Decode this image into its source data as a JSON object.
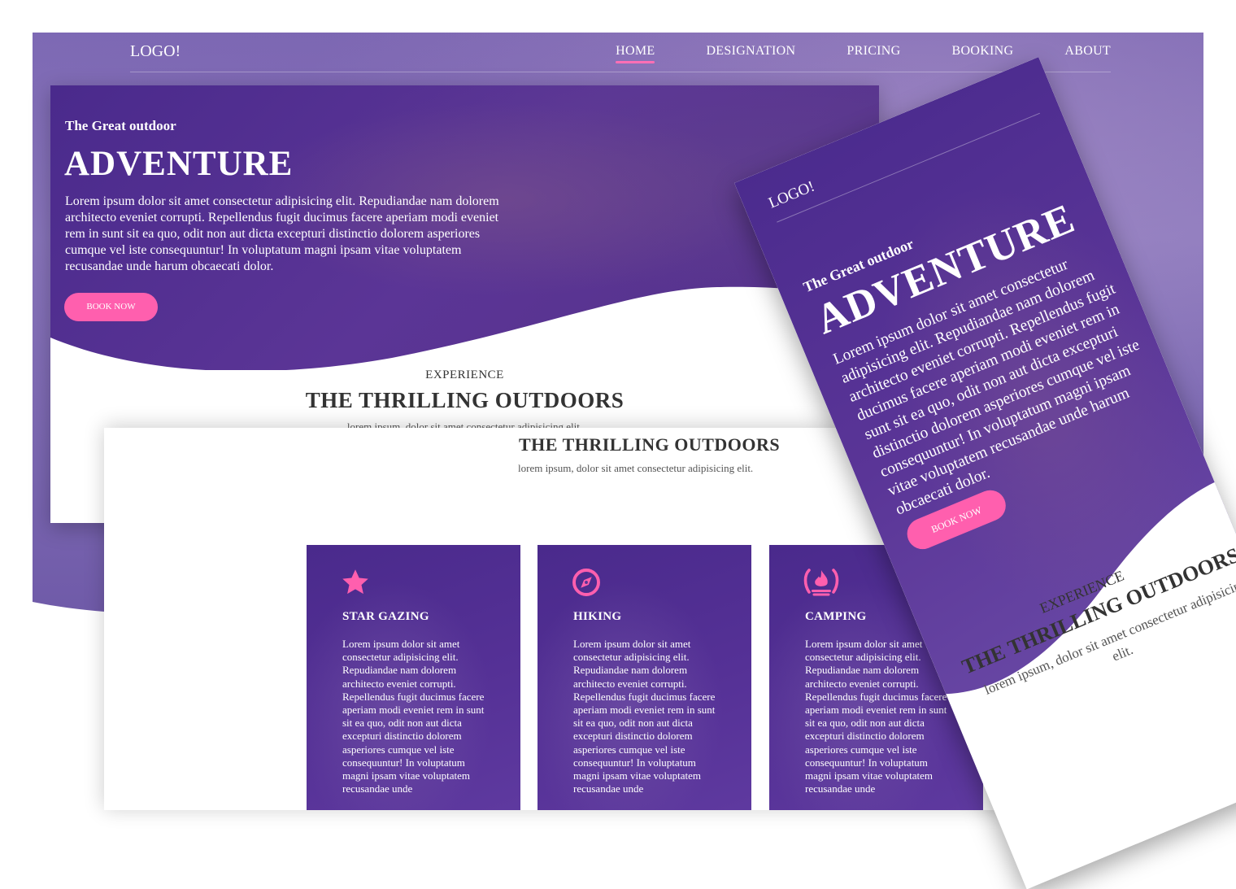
{
  "nav": {
    "logo": "LOGO!",
    "links": [
      "HOME",
      "DESIGNATION",
      "PRICING",
      "BOOKING",
      "ABOUT"
    ]
  },
  "hero": {
    "eyebrow": "The Great outdoor",
    "title": "ADVENTURE",
    "description": "Lorem ipsum dolor sit amet consectetur adipisicing elit. Repudiandae nam dolorem architecto eveniet corrupti. Repellendus fugit ducimus facere aperiam modi eveniet rem in sunt sit ea quo, odit non aut dicta excepturi distinctio dolorem asperiores cumque vel iste consequuntur! In voluptatum magni ipsam vitae voluptatem recusandae unde harum obcaecati dolor.",
    "cta": "BOOK NOW"
  },
  "experience": {
    "eyebrow": "EXPERIENCE",
    "title": "THE THRILLING OUTDOORS",
    "subtitle": "lorem ipsum, dolor sit amet consectetur adipisicing elit."
  },
  "features": [
    {
      "icon": "star-icon",
      "title": "STAR GAZING",
      "text": "Lorem ipsum dolor sit amet consectetur adipisicing elit. Repudiandae nam dolorem architecto eveniet corrupti. Repellendus fugit ducimus facere aperiam modi eveniet rem in sunt sit ea quo, odit non aut dicta excepturi distinctio dolorem asperiores cumque vel iste consequuntur! In voluptatum magni ipsam vitae voluptatem recusandae unde"
    },
    {
      "icon": "compass-icon",
      "title": "HIKING",
      "text": "Lorem ipsum dolor sit amet consectetur adipisicing elit. Repudiandae nam dolorem architecto eveniet corrupti. Repellendus fugit ducimus facere aperiam modi eveniet rem in sunt sit ea quo, odit non aut dicta excepturi distinctio dolorem asperiores cumque vel iste consequuntur! In voluptatum magni ipsam vitae voluptatem recusandae unde"
    },
    {
      "icon": "campfire-icon",
      "title": "CAMPING",
      "text": "Lorem ipsum dolor sit amet consectetur adipisicing elit. Repudiandae nam dolorem architecto eveniet corrupti. Repellendus fugit ducimus facere aperiam modi eveniet rem in sunt sit ea quo, odit non aut dicta excepturi distinctio dolorem asperiores cumque vel iste consequuntur! In voluptatum magni ipsam vitae voluptatem recusandae unde"
    }
  ],
  "mobile": {
    "logo": "LOGO!",
    "menu_icon": "hamburger-menu-icon",
    "eyebrow": "The Great outdoor",
    "title": "ADVENTURE",
    "description": "Lorem ipsum dolor sit amet consectetur adipisicing elit. Repudiandae nam dolorem architecto eveniet corrupti. Repellendus fugit ducimus facere aperiam modi eveniet rem in sunt sit ea quo, odit non aut dicta excepturi distinctio dolorem asperiores cumque vel iste consequuntur! In voluptatum magni ipsam vitae voluptatem recusandae unde harum obcaecati dolor.",
    "cta": "BOOK NOW",
    "exp_eyebrow": "EXPERIENCE",
    "exp_title": "THE THRILLING OUTDOORS",
    "exp_subtitle": "lorem ipsum, dolor sit amet consectetur adipisicing elit."
  },
  "colors": {
    "accent": "#ff5fae",
    "hero_purple": "#4b2b8e",
    "background_purple": "#7d69b4"
  }
}
